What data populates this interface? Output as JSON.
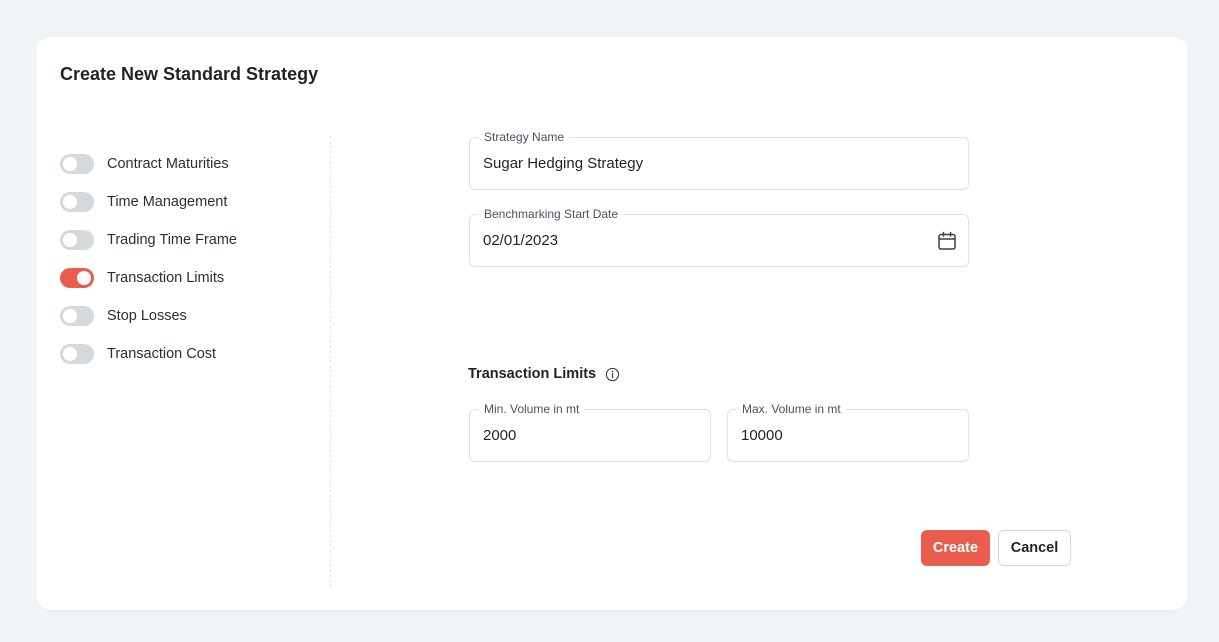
{
  "dialog": {
    "title": "Create New Standard Strategy"
  },
  "toggles": [
    {
      "label": "Contract Maturities",
      "on": false
    },
    {
      "label": "Time Management",
      "on": false
    },
    {
      "label": "Trading Time Frame",
      "on": false
    },
    {
      "label": "Transaction Limits",
      "on": true
    },
    {
      "label": "Stop Losses",
      "on": false
    },
    {
      "label": "Transaction Cost",
      "on": false
    }
  ],
  "form": {
    "strategy_name": {
      "label": "Strategy Name",
      "value": "Sugar Hedging Strategy"
    },
    "benchmark_date": {
      "label": "Benchmarking Start Date",
      "value": "02/01/2023",
      "icon": "calendar-icon"
    }
  },
  "transaction_limits": {
    "title": "Transaction Limits",
    "info_icon": "info-icon",
    "min_volume": {
      "label": "Min. Volume in mt",
      "value": "2000"
    },
    "max_volume": {
      "label": "Max. Volume in mt",
      "value": "10000"
    }
  },
  "actions": {
    "create_label": "Create",
    "cancel_label": "Cancel"
  },
  "colors": {
    "accent": "#e85d4d",
    "toggle_off": "#d5d8dd",
    "background": "#f1f4f7"
  }
}
